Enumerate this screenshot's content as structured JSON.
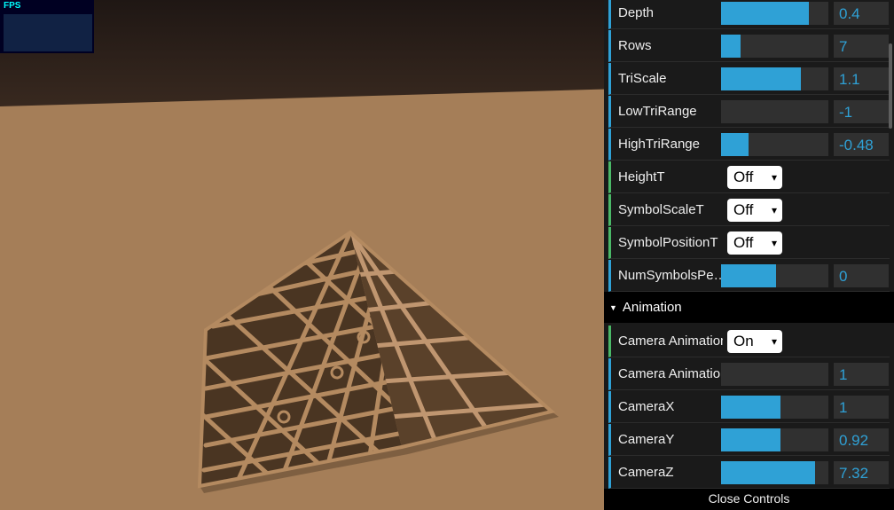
{
  "fps": {
    "label": "FPS"
  },
  "controls": [
    {
      "type": "number",
      "label": "Depth",
      "value": "0.4",
      "fill": 0.82
    },
    {
      "type": "number",
      "label": "Rows",
      "value": "7",
      "fill": 0.18
    },
    {
      "type": "number",
      "label": "TriScale",
      "value": "1.1",
      "fill": 0.74
    },
    {
      "type": "number",
      "label": "LowTriRange",
      "value": "-1",
      "fill": 0.0
    },
    {
      "type": "number",
      "label": "HighTriRange",
      "value": "-0.48",
      "fill": 0.26
    },
    {
      "type": "select",
      "label": "HeightT",
      "value": "Off"
    },
    {
      "type": "select",
      "label": "SymbolScaleT",
      "value": "Off"
    },
    {
      "type": "select",
      "label": "SymbolPositionT",
      "value": "Off"
    },
    {
      "type": "number",
      "label": "NumSymbolsPe…",
      "value": "0",
      "fill": 0.51
    }
  ],
  "animation_folder": {
    "title": "Animation",
    "controls": [
      {
        "type": "select",
        "label": "Camera Animation",
        "value": "On"
      },
      {
        "type": "number",
        "label": "Camera Animation",
        "value": "1",
        "fill": 0.0
      },
      {
        "type": "number",
        "label": "CameraX",
        "value": "1",
        "fill": 0.55
      },
      {
        "type": "number",
        "label": "CameraY",
        "value": "0.92",
        "fill": 0.55
      },
      {
        "type": "number",
        "label": "CameraZ",
        "value": "7.32",
        "fill": 0.88
      }
    ]
  },
  "close_label": "Close Controls",
  "colors": {
    "accent": "#2fa1d6",
    "panel": "#1a1a1a",
    "field": "#303030",
    "ground": "#a57e58",
    "pyramid": "#8a6640"
  }
}
